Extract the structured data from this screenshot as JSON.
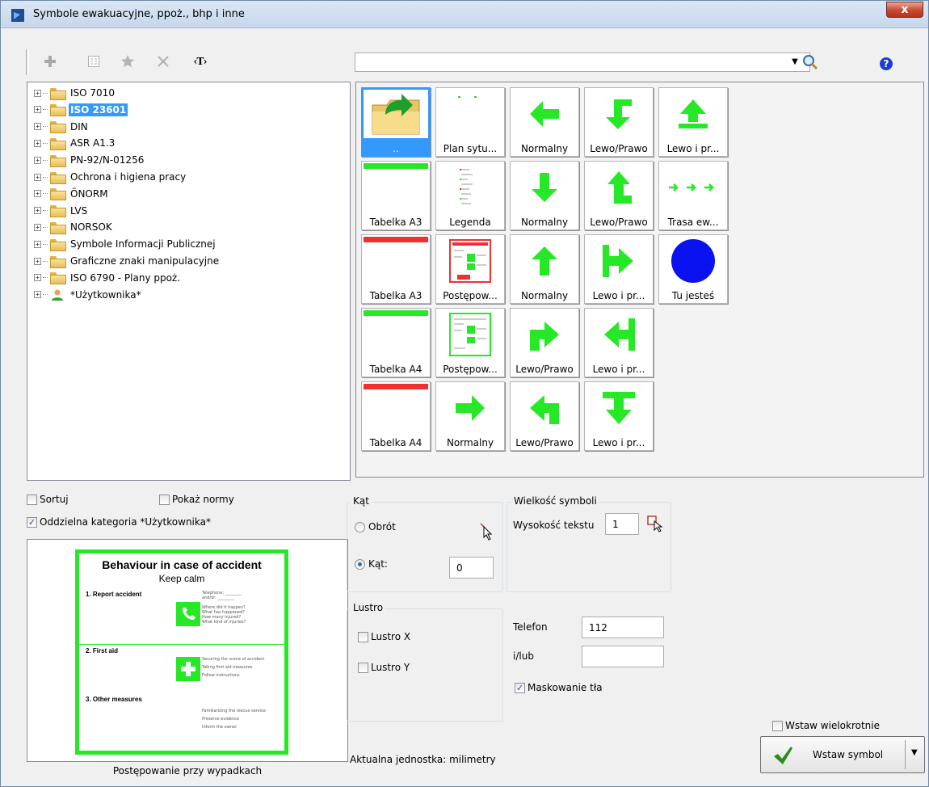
{
  "window": {
    "title": "Symbole ewakuacyjne, ppoż., bhp i inne",
    "close_label": "x"
  },
  "toolbar": {
    "icons": [
      "plus-icon",
      "properties-icon",
      "star-icon",
      "delete-icon",
      "text-tag-icon"
    ],
    "text_tag_label": "‹T›",
    "search_value": ""
  },
  "tree": [
    {
      "label": "ISO 7010",
      "icon": "folder"
    },
    {
      "label": "ISO 23601",
      "icon": "folder-open",
      "selected": true
    },
    {
      "label": "DIN",
      "icon": "folder"
    },
    {
      "label": "ASR A1.3",
      "icon": "folder"
    },
    {
      "label": "PN-92/N-01256",
      "icon": "folder"
    },
    {
      "label": "Ochrona i higiena pracy",
      "icon": "folder"
    },
    {
      "label": "ÖNORM",
      "icon": "folder"
    },
    {
      "label": "LVS",
      "icon": "folder"
    },
    {
      "label": "NORSOK",
      "icon": "folder"
    },
    {
      "label": "Symbole Informacji Publicznej",
      "icon": "folder"
    },
    {
      "label": "Graficzne znaki manipulacyjne",
      "icon": "folder"
    },
    {
      "label": "ISO 6790 - Plany ppoż.",
      "icon": "folder"
    },
    {
      "label": "*Użytkownika*",
      "icon": "user"
    }
  ],
  "symbols": [
    {
      "label": "..",
      "icon": "up-folder-icon",
      "selected": true
    },
    {
      "label": "Plan sytu...",
      "icon": "plan-icon"
    },
    {
      "label": "Normalny",
      "icon": "arrow-left-icon"
    },
    {
      "label": "Lewo/Prawo",
      "icon": "arrow-down-left-icon"
    },
    {
      "label": "Lewo i pr...",
      "icon": "arrow-up-bar-icon"
    },
    {
      "label": "Tabelka A3",
      "icon": "table-green-icon"
    },
    {
      "label": "Legenda",
      "icon": "legend-icon"
    },
    {
      "label": "Normalny",
      "icon": "arrow-down-icon"
    },
    {
      "label": "Lewo/Prawo",
      "icon": "arrow-up-turn-icon"
    },
    {
      "label": "Trasa ew...",
      "icon": "route-arrows-icon"
    },
    {
      "label": "Tabelka A3",
      "icon": "table-red-icon"
    },
    {
      "label": "Postępow...",
      "icon": "procedure-red-icon"
    },
    {
      "label": "Normalny",
      "icon": "arrow-up-icon"
    },
    {
      "label": "Lewo i pr...",
      "icon": "arrow-right-bar-icon"
    },
    {
      "label": "Tu jesteś",
      "icon": "blue-dot-icon"
    },
    {
      "label": "Tabelka A4",
      "icon": "table-green-icon"
    },
    {
      "label": "Postępow...",
      "icon": "procedure-green-icon"
    },
    {
      "label": "Lewo/Prawo",
      "icon": "arrow-up-right-icon"
    },
    {
      "label": "Lewo i pr...",
      "icon": "arrow-left-bar-icon"
    },
    {
      "label": "Tabelka A4",
      "icon": "table-red-icon"
    },
    {
      "label": "Normalny",
      "icon": "arrow-right-icon"
    },
    {
      "label": "Lewo/Prawo",
      "icon": "arrow-up-left-icon"
    },
    {
      "label": "Lewo i pr...",
      "icon": "arrow-down-bar-icon"
    }
  ],
  "options": {
    "sort_label": "Sortuj",
    "sort_checked": false,
    "show_norms_label": "Pokaż normy",
    "show_norms_checked": false,
    "separate_user_label": "Oddzielna kategoria *Użytkownika*",
    "separate_user_checked": true
  },
  "preview": {
    "caption": "Postępowanie przy wypadkach",
    "title": "Behaviour in case of accident",
    "subtitle": "Keep calm",
    "section1": "1. Report accident",
    "section2": "2. First aid",
    "section3": "3. Other measures"
  },
  "angle": {
    "group_label": "Kąt",
    "rotation_label": "Obrót",
    "angle_label": "Kąt:",
    "angle_value": "0",
    "selected": "angle"
  },
  "mirror": {
    "group_label": "Lustro",
    "x_label": "Lustro X",
    "x_checked": false,
    "y_label": "Lustro Y",
    "y_checked": false
  },
  "size": {
    "group_label": "Wielkość symboli",
    "text_height_label": "Wysokość tekstu",
    "text_height_value": "1"
  },
  "phone": {
    "label": "Telefon",
    "value": "112",
    "and_or_label": "i/lub",
    "and_or_value": ""
  },
  "mask": {
    "label": "Maskowanie tła",
    "checked": true
  },
  "insert": {
    "multiple_label": "Wstaw wielokrotnie",
    "multiple_checked": false,
    "button_label": "Wstaw symbol"
  },
  "units": "Aktualna jednostka: milimetry",
  "colors": {
    "accent": "#3399ff",
    "sign_green": "#27e827",
    "title_bar": "#c6d7ec"
  }
}
